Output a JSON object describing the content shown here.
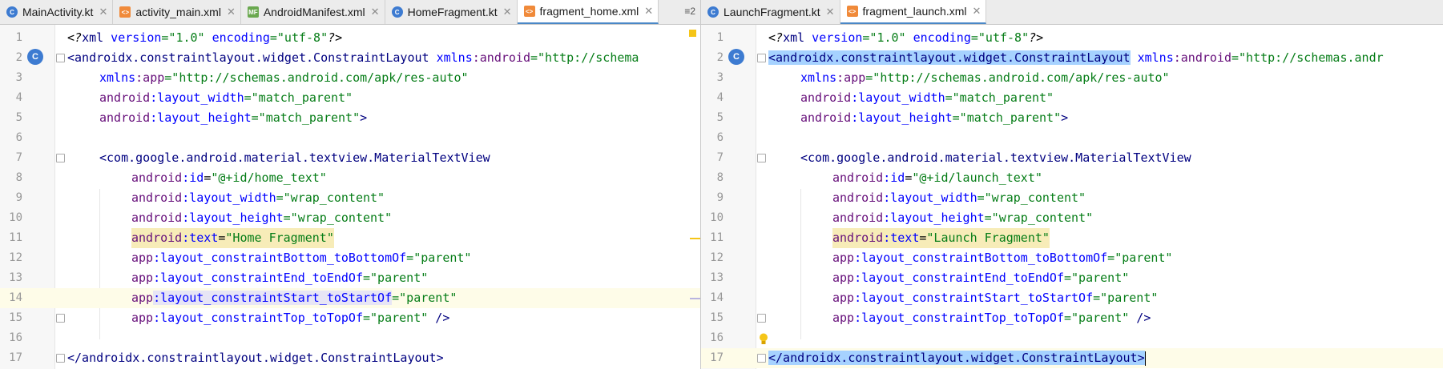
{
  "left": {
    "tabs": [
      {
        "label": "MainActivity.kt",
        "icon": "kotlin-class-icon",
        "active": false
      },
      {
        "label": "activity_main.xml",
        "icon": "xml-file-icon",
        "active": false
      },
      {
        "label": "AndroidManifest.xml",
        "icon": "manifest-file-icon",
        "active": false
      },
      {
        "label": "HomeFragment.kt",
        "icon": "kotlin-class-icon",
        "active": false
      },
      {
        "label": "fragment_home.xml",
        "icon": "xml-file-icon",
        "active": true
      }
    ],
    "tab_menu": "≡2",
    "lines": [
      "1",
      "2",
      "3",
      "4",
      "5",
      "6",
      "7",
      "8",
      "9",
      "10",
      "11",
      "12",
      "13",
      "14",
      "15",
      "16",
      "17"
    ],
    "id_value": "\"@+id/home_text\"",
    "text_value": "\"Home Fragment\""
  },
  "right": {
    "tabs": [
      {
        "label": "LaunchFragment.kt",
        "icon": "kotlin-class-icon",
        "active": false
      },
      {
        "label": "fragment_launch.xml",
        "icon": "xml-file-icon",
        "active": true
      }
    ],
    "lines": [
      "1",
      "2",
      "3",
      "4",
      "5",
      "6",
      "7",
      "8",
      "9",
      "10",
      "11",
      "12",
      "13",
      "14",
      "15",
      "16",
      "17"
    ],
    "id_value": "\"@+id/launch_text\"",
    "text_value": "\"Launch Fragment\""
  },
  "code": {
    "xml_decl_open": "<?",
    "xml_decl_name": "xml",
    "xml_decl_version_attr": " version",
    "xml_decl_version_val": "=\"1.0\"",
    "xml_decl_enc_attr": " encoding",
    "xml_decl_enc_val": "=\"utf-8\"",
    "xml_decl_close": "?>",
    "root_open": "<androidx.constraintlayout.widget.ConstraintLayout",
    "xmlns_prefix": " xmlns",
    "android_ns": ":android",
    "xmlns_android_val_left": "=\"http://schema",
    "xmlns_android_val_right": "=\"http://schemas.andr",
    "xmlns": "xmlns",
    "app": ":app",
    "app_val": "=\"http://schemas.android.com/apk/res-auto\"",
    "android": "android",
    "app_prefix": "app",
    "layout_width": ":layout_width",
    "layout_height": ":layout_height",
    "match_parent": "=\"match_parent\"",
    "match_parent_close": "=\"match_parent\"",
    "gt": ">",
    "material_tv": "<com.google.android.material.textview.MaterialTextView",
    "id_attr": ":id",
    "wrap_content": "=\"wrap_content\"",
    "text_attr": ":text",
    "eq": "=",
    "c_bottom": ":layout_constraintBottom_toBottomOf",
    "c_end": ":layout_constraintEnd_toEndOf",
    "c_start": ":layout_constraintStart_toStartOf",
    "c_top": ":layout_constraintTop_toTopOf",
    "parent": "=\"parent\"",
    "parent_close": "=\"parent\"",
    "self_close": " />",
    "root_close": "</androidx.constraintlayout.widget.ConstraintLayout>",
    "c_badge": "C"
  },
  "colors": {
    "tab_active_underline": "#4a88c7",
    "selection": "#a6d2ff",
    "identifier_highlight": "#f7ecb8",
    "current_line": "#fefce8"
  }
}
